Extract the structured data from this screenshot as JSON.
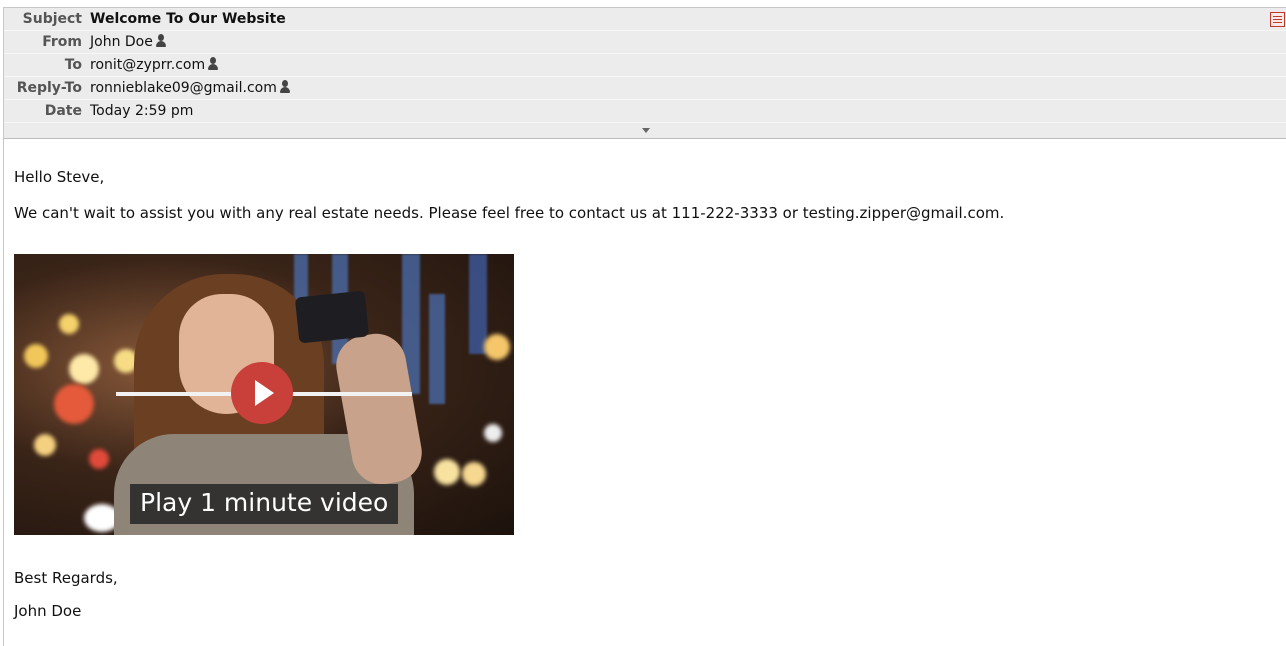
{
  "header": {
    "subject_label": "Subject",
    "subject_value": "Welcome To Our Website",
    "from_label": "From",
    "from_value": "John Doe",
    "to_label": "To",
    "to_value": "ronit@zyprr.com",
    "replyto_label": "Reply-To",
    "replyto_value": "ronnieblake09@gmail.com",
    "date_label": "Date",
    "date_value": "Today 2:59 pm",
    "icons": {
      "contact": "person-icon",
      "print": "print-icon",
      "expand": "chevron-down-icon"
    },
    "colors": {
      "header_bg": "#ececec",
      "print_icon": "#c0392b",
      "play_button": "#c9403b"
    }
  },
  "message": {
    "greeting": "Hello Steve,",
    "intro": "We can't wait to assist you with any real estate needs. Please feel free to contact us at 111-222-3333 or testing.zipper@gmail.com.",
    "video_caption": "Play 1 minute video",
    "closing": "Best Regards,",
    "signature": "John Doe"
  }
}
